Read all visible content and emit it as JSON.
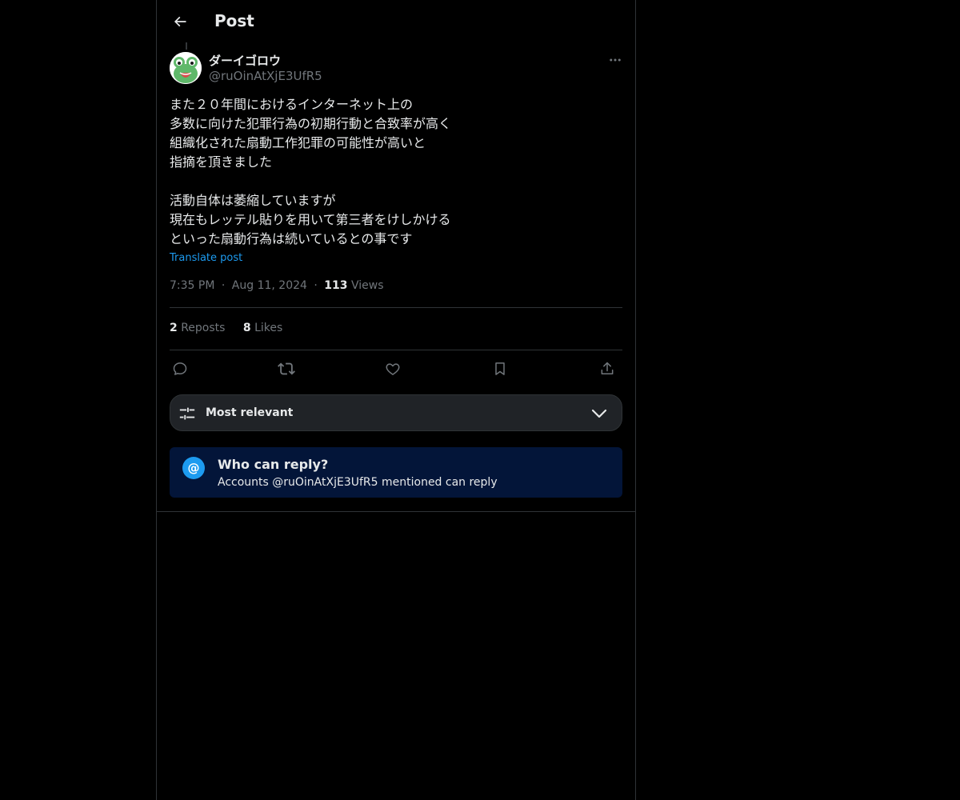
{
  "header": {
    "title": "Post"
  },
  "author": {
    "display_name": "ダーイゴロウ",
    "handle": "@ruOinAtXjE3UfR5"
  },
  "post": {
    "lines": [
      "また２０年間におけるインターネット上の",
      "多数に向けた犯罪行為の初期行動と合致率が高く",
      "組織化された扇動工作犯罪の可能性が高いと",
      "指摘を頂きました",
      "",
      "活動自体は萎縮していますが",
      "現在もレッテル貼りを用いて第三者をけしかける",
      "といった扇動行為は続いているとの事です"
    ],
    "translate_label": "Translate post",
    "time": "7:35 PM",
    "date": "Aug 11, 2024",
    "views_count": "113",
    "views_label": "Views",
    "separator": "·"
  },
  "stats": {
    "reposts_count": "2",
    "reposts_label": "Reposts",
    "likes_count": "8",
    "likes_label": "Likes"
  },
  "sort": {
    "label": "Most relevant"
  },
  "reply_restriction": {
    "title": "Who can reply?",
    "subtitle": "Accounts @ruOinAtXjE3UfR5 mentioned can reply",
    "icon_glyph": "@"
  },
  "colors": {
    "background": "#000000",
    "accent": "#1d9bf0",
    "muted_text": "#71767b",
    "border": "#2f3336",
    "reply_box_bg": "#031539"
  },
  "icons": {
    "back": "back-arrow-icon",
    "more": "more-dots-icon",
    "reply": "reply-icon",
    "repost": "repost-icon",
    "like": "heart-icon",
    "bookmark": "bookmark-icon",
    "share": "share-icon",
    "sort": "sliders-icon",
    "chevron": "chevron-down-icon",
    "mention": "at-icon"
  }
}
